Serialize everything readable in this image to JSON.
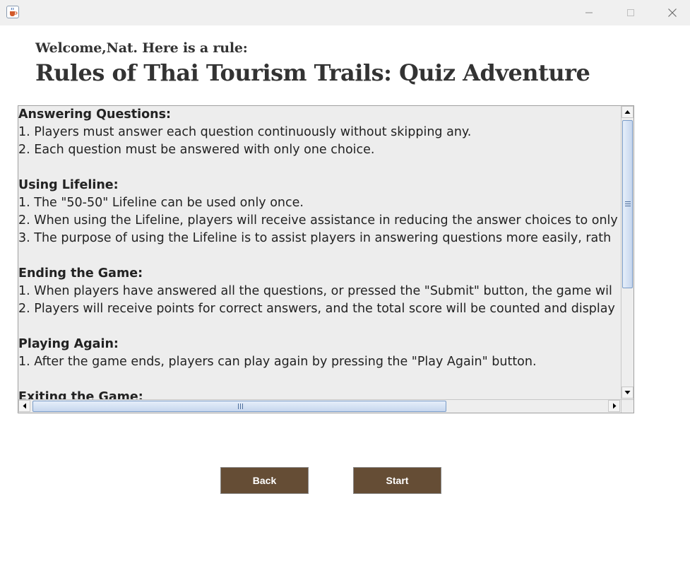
{
  "window": {
    "app_icon": "java-cup-icon",
    "controls": [
      "minimize-icon",
      "maximize-icon",
      "close-icon"
    ]
  },
  "header": {
    "welcome": "Welcome,Nat.  Here is a rule:",
    "title": "Rules of Thai Tourism Trails: Quiz Adventure"
  },
  "rules": {
    "lines": [
      {
        "text": "Answering Questions:",
        "heading": true
      },
      {
        "text": "1. Players must answer each question continuously without skipping any.",
        "heading": false
      },
      {
        "text": "2. Each question must be answered with only one choice.",
        "heading": false
      },
      {
        "text": "",
        "heading": false
      },
      {
        "text": "Using Lifeline:",
        "heading": true
      },
      {
        "text": "1. The \"50-50\" Lifeline can be used only once.",
        "heading": false
      },
      {
        "text": "2. When using the Lifeline, players will receive assistance in reducing the answer choices to only",
        "heading": false
      },
      {
        "text": "3. The purpose of using the Lifeline is to assist players in answering questions more easily, rath",
        "heading": false
      },
      {
        "text": "",
        "heading": false
      },
      {
        "text": "Ending the Game:",
        "heading": true
      },
      {
        "text": "1. When players have answered all the questions, or pressed the \"Submit\" button, the game wil",
        "heading": false
      },
      {
        "text": "2. Players will receive points for correct answers, and the total score will be counted and display",
        "heading": false
      },
      {
        "text": "",
        "heading": false
      },
      {
        "text": "Playing Again:",
        "heading": true
      },
      {
        "text": "1. After the game ends, players can play again by pressing the \"Play Again\" button.",
        "heading": false
      },
      {
        "text": "",
        "heading": false
      },
      {
        "text": "Exiting the Game:",
        "heading": true
      }
    ],
    "vertical_scroll_position": 0.0,
    "horizontal_scroll_position": 0.0
  },
  "buttons": {
    "back": "Back",
    "start": "Start"
  },
  "colors": {
    "button_background": "#654d35",
    "button_text": "#ffffff",
    "text_area_background": "#ededed",
    "heading_text": "#333333"
  }
}
